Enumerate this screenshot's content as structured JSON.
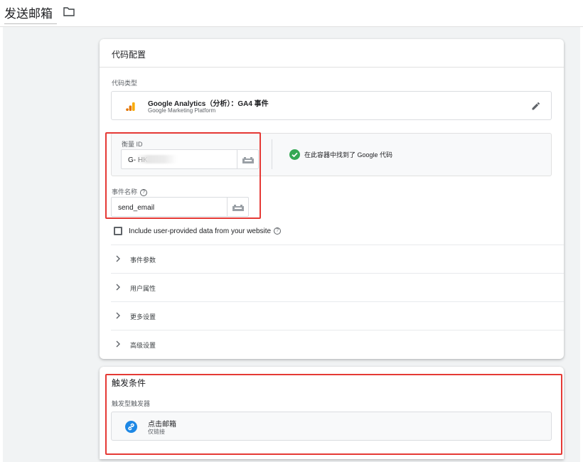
{
  "header": {
    "tag_name": "发送邮箱",
    "folder_icon": "folder-icon"
  },
  "tag_config": {
    "title": "代码配置",
    "tag_type_label": "代码类型",
    "tag_type": {
      "name": "Google Analytics（分析）：GA4 事件",
      "platform": "Google Marketing Platform",
      "icon": "google-analytics-icon",
      "edit_icon": "pencil-icon"
    },
    "measurement_id": {
      "label": "衡量 ID",
      "value": "G-            HK1",
      "found_message": "在此容器中找到了 Google 代码",
      "status_icon": "check-circle-icon",
      "status_color": "#34a853"
    },
    "event_name": {
      "label": "事件名称",
      "value": "send_email"
    },
    "user_data_checkbox": {
      "label": "Include user-provided data from your website",
      "checked": false
    },
    "sections": [
      "事件参数",
      "用户属性",
      "更多设置",
      "高级设置"
    ]
  },
  "triggering": {
    "title": "触发条件",
    "label": "触发型触发器",
    "trigger": {
      "name": "点击邮箱",
      "type": "仅链接",
      "icon": "link-icon",
      "icon_color": "#1e88e5"
    }
  },
  "colors": {
    "ga_orange": "#f9ab00",
    "ga_dark_orange": "#e37400",
    "annotation_red": "#e53935"
  }
}
